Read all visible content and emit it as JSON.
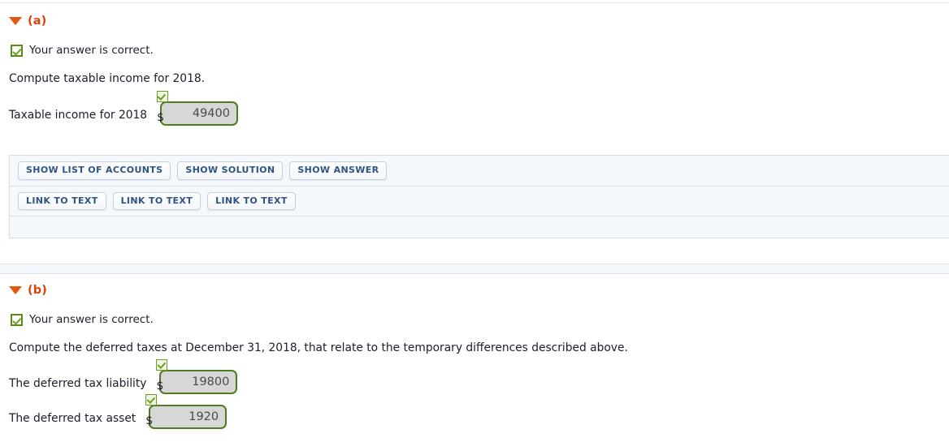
{
  "colors": {
    "accent_orange": "#d8440b",
    "check_green": "#5b8a1b",
    "field_border_green": "#4f7d1e",
    "field_fill_grey": "#d7d7d7",
    "button_text_navy": "#2d5484",
    "panel_bg": "#f4f8fc",
    "rule": "#dce3ec",
    "body_text": "#1d1d2b"
  },
  "parts": [
    {
      "id": "a",
      "toggle_icon": "caret-down-icon",
      "label": "(a)",
      "status": {
        "icon": "check-icon",
        "text": "Your answer is correct."
      },
      "prompt": "Compute taxable income for 2018.",
      "fields": [
        {
          "label": "Taxable income for 2018",
          "currency": "$",
          "value": "49400",
          "placeholder": "",
          "status_icon": "check-icon"
        }
      ],
      "action_rows": [
        [
          {
            "label": "SHOW LIST OF ACCOUNTS",
            "name": "show-list-of-accounts-button"
          },
          {
            "label": "SHOW SOLUTION",
            "name": "show-solution-button"
          },
          {
            "label": "SHOW ANSWER",
            "name": "show-answer-button"
          }
        ],
        [
          {
            "label": "LINK TO TEXT",
            "name": "link-to-text-button-1"
          },
          {
            "label": "LINK TO TEXT",
            "name": "link-to-text-button-2"
          },
          {
            "label": "LINK TO TEXT",
            "name": "link-to-text-button-3"
          }
        ]
      ]
    },
    {
      "id": "b",
      "toggle_icon": "caret-down-icon",
      "label": "(b)",
      "status": {
        "icon": "check-icon",
        "text": "Your answer is correct."
      },
      "prompt": "Compute the deferred taxes at December 31, 2018, that relate to the temporary differences described above.",
      "fields": [
        {
          "label": "The deferred tax liability",
          "currency": "$",
          "value": "19800",
          "placeholder": "",
          "status_icon": "check-icon"
        },
        {
          "label": "The deferred tax asset",
          "currency": "$",
          "value": "1920",
          "placeholder": "",
          "status_icon": "check-icon"
        }
      ]
    }
  ]
}
